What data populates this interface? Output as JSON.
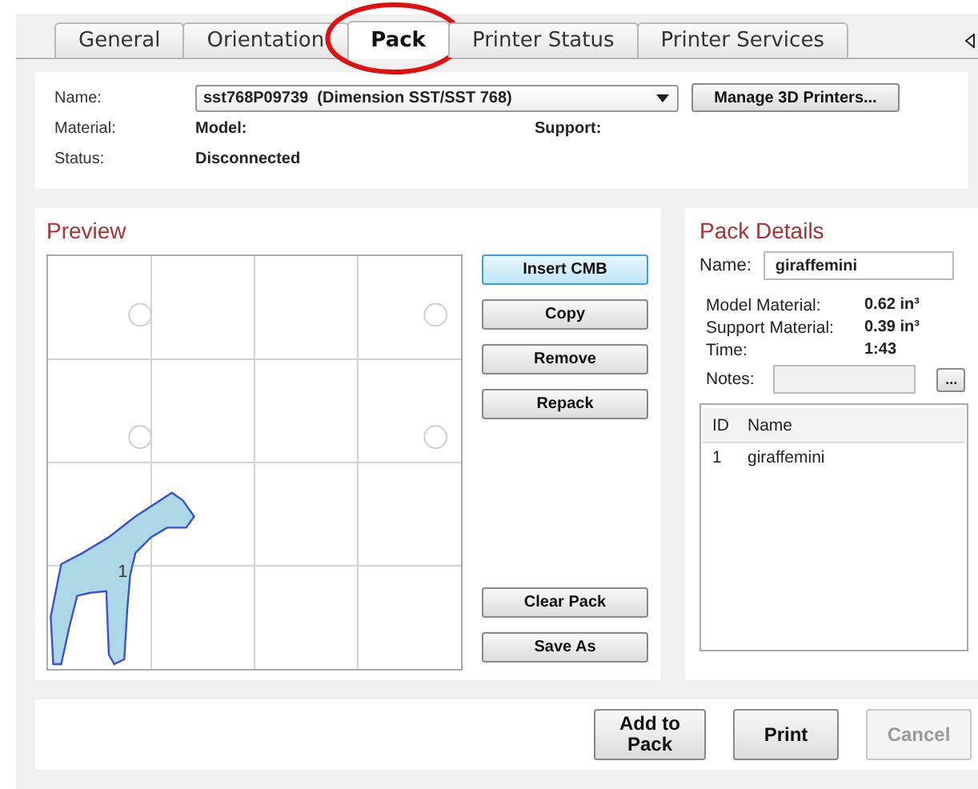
{
  "tabs": [
    {
      "label": "General",
      "selected": false
    },
    {
      "label": "Orientation",
      "selected": false
    },
    {
      "label": "Pack",
      "selected": true
    },
    {
      "label": "Printer Status",
      "selected": false
    },
    {
      "label": "Printer Services",
      "selected": false
    }
  ],
  "printer": {
    "name_label": "Name:",
    "name_value": "sst768P09739  (Dimension SST/SST 768)",
    "manage_button": "Manage 3D Printers...",
    "material_label": "Material:",
    "model_label": "Model:",
    "support_label": "Support:",
    "status_label": "Status:",
    "status_value": "Disconnected"
  },
  "preview": {
    "title": "Preview",
    "part_label": "1",
    "buttons_top": [
      {
        "label": "Insert CMB",
        "default": true
      },
      {
        "label": "Copy",
        "default": false
      },
      {
        "label": "Remove",
        "default": false
      },
      {
        "label": "Repack",
        "default": false
      }
    ],
    "buttons_bottom": [
      {
        "label": "Clear Pack",
        "default": false
      },
      {
        "label": "Save As",
        "default": false
      }
    ]
  },
  "pack_details": {
    "title": "Pack Details",
    "name_label": "Name:",
    "name_value": "giraffemini",
    "stats": [
      {
        "label": "Model Material:",
        "value": "0.62 in³"
      },
      {
        "label": "Support Material:",
        "value": "0.39 in³"
      },
      {
        "label": "Time:",
        "value": "1:43"
      }
    ],
    "notes_label": "Notes:",
    "notes_button": "...",
    "table": {
      "columns": [
        "ID",
        "Name"
      ],
      "rows": [
        [
          "1",
          "giraffemini"
        ]
      ]
    }
  },
  "footer_buttons": [
    {
      "label": "Add to Pack",
      "disabled": false
    },
    {
      "label": "Print",
      "disabled": false
    },
    {
      "label": "Cancel",
      "disabled": true
    }
  ]
}
